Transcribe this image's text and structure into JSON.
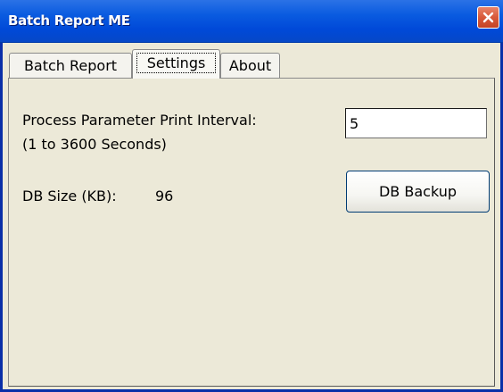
{
  "window": {
    "title": "Batch Report ME"
  },
  "tabs": [
    {
      "label": "Batch Report",
      "active": false
    },
    {
      "label": "Settings",
      "active": true
    },
    {
      "label": "About",
      "active": false
    }
  ],
  "settings": {
    "interval_label": "Process Parameter Print Interval:",
    "interval_range_label": "(1 to 3600 Seconds)",
    "interval_value": "5",
    "db_size_label": "DB Size (KB):",
    "db_size_value": "96",
    "backup_button_label": "DB Backup"
  },
  "colors": {
    "titlebar": "#0049d8",
    "close_button": "#d8593a",
    "face": "#ece9d8"
  },
  "icons": {
    "close": "close-icon"
  }
}
